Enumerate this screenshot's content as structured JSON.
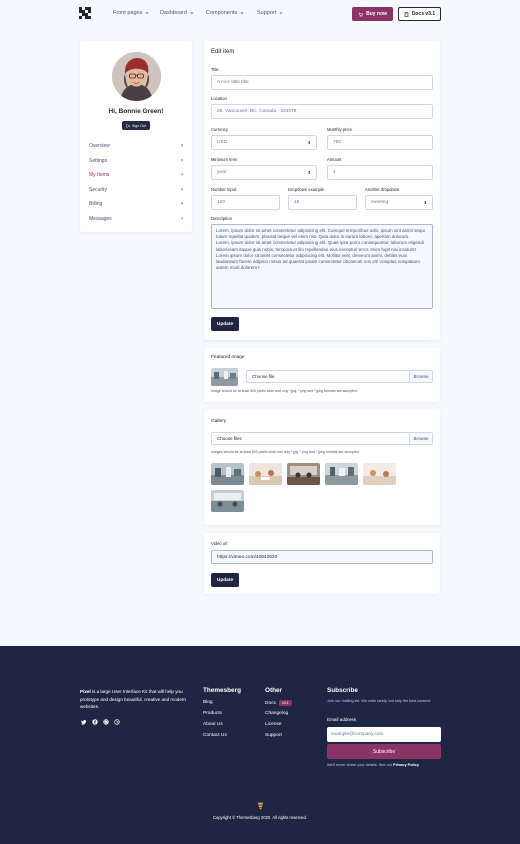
{
  "nav": {
    "items": [
      {
        "label": "Front pages"
      },
      {
        "label": "Dashboard"
      },
      {
        "label": "Components"
      },
      {
        "label": "Support"
      }
    ],
    "buy_label": "Buy now",
    "docs_label": "Docs v3.1"
  },
  "profile": {
    "greeting": "Hi, Bonnie Green!",
    "signout_label": "Sign Out",
    "menu": [
      {
        "label": "Overview",
        "active": false
      },
      {
        "label": "Settings",
        "active": false
      },
      {
        "label": "My Items",
        "active": true
      },
      {
        "label": "Security",
        "active": false
      },
      {
        "label": "Billing",
        "active": false
      },
      {
        "label": "Messages",
        "active": false
      }
    ]
  },
  "edit": {
    "title": "Edit item",
    "title_label": "Title",
    "title_value": "A nice little title",
    "location_label": "Location",
    "location_value": "26, Vancouver, BC, Canada - 324578",
    "currency_label": "Currency",
    "currency_value": "USD",
    "monthly_label": "Monthly price",
    "monthly_value": "750",
    "minterm_label": "Minimum term",
    "minterm_value": "year",
    "amount_label": "Amount",
    "amount_value": "1",
    "number_label": "Number input",
    "number_value": "100",
    "dropdown_label": "Dropdown example",
    "dropdown_value": "15",
    "another_label": "Another dropdown",
    "another_value": "meeting",
    "desc_label": "Description",
    "description": "Lorem, ipsum dolor sit amet consectetur adipisicing elit. Cumque temporibus odio, ipsum sint animi sequi totam repellat quidem, placeat neque vel enim nisi. Quia dolor in earum labore, aperiam dolorum.\nLorem, ipsum dolor sit amet consectetur adipisicing elit. Quae ipsa porro consequuntur, laborum eligendi laboriosam itaque quis nobis, tempora et illo repellendus eius excepturi error, enim fugit nisi incidunt!\nLorem ipsum dolor sit amet consectetur adipisicing elit. Mollitia velit, deserunt animi, debitis eum laudantium facere adipisci minus ad quaerat ipsam consectetur obcaecati non sit! Voluptas voluptatum autem modi dolorem?",
    "update_label": "Update"
  },
  "featured": {
    "title": "Featured image",
    "file_placeholder": "Choose file",
    "browse_label": "Browse",
    "hint": "Image should be at least 500 pixels wide and only *.jpg, *.png and *.jpeg formats are accepted."
  },
  "gallery": {
    "title": "Gallery",
    "file_placeholder": "Choose files",
    "browse_label": "Browse",
    "hint": "Images should be at least 500 pixels wide and only *.jpg, *.png and *.jpeg formats are accepted.",
    "thumbs": [
      "office-photo-1",
      "office-photo-2",
      "office-photo-3",
      "office-photo-4",
      "office-photo-5",
      "office-photo-6"
    ]
  },
  "video": {
    "title": "Video url",
    "value": "https://vimeo.com/40842620",
    "update_label": "Update"
  },
  "footer": {
    "brand": "Pixel",
    "description": " is a large User Interface Kit that will help you prototype and design beautiful, creative and modern websites.",
    "col1_title": "Themesberg",
    "col1_links": [
      "Blog",
      "Products",
      "About Us",
      "Contact Us"
    ],
    "col2_title": "Other",
    "col2_links": [
      "Docs",
      "Changelog",
      "License",
      "Support"
    ],
    "docs_badge": "v3.1",
    "subscribe_title": "Subscribe",
    "subscribe_desc": "Join our mailing list. We write rarely, but only the best content.",
    "email_label": "Email address",
    "email_placeholder": "example@company.com",
    "subscribe_button": "Subscribe",
    "privacy_text": "We'll never share your details. See our ",
    "privacy_link": "Privacy Policy",
    "copyright": "Copyright © Themesberg 2020. All rights reserved.",
    "colors": {
      "bg": "#1f2643",
      "accent": "#8b3566"
    }
  }
}
